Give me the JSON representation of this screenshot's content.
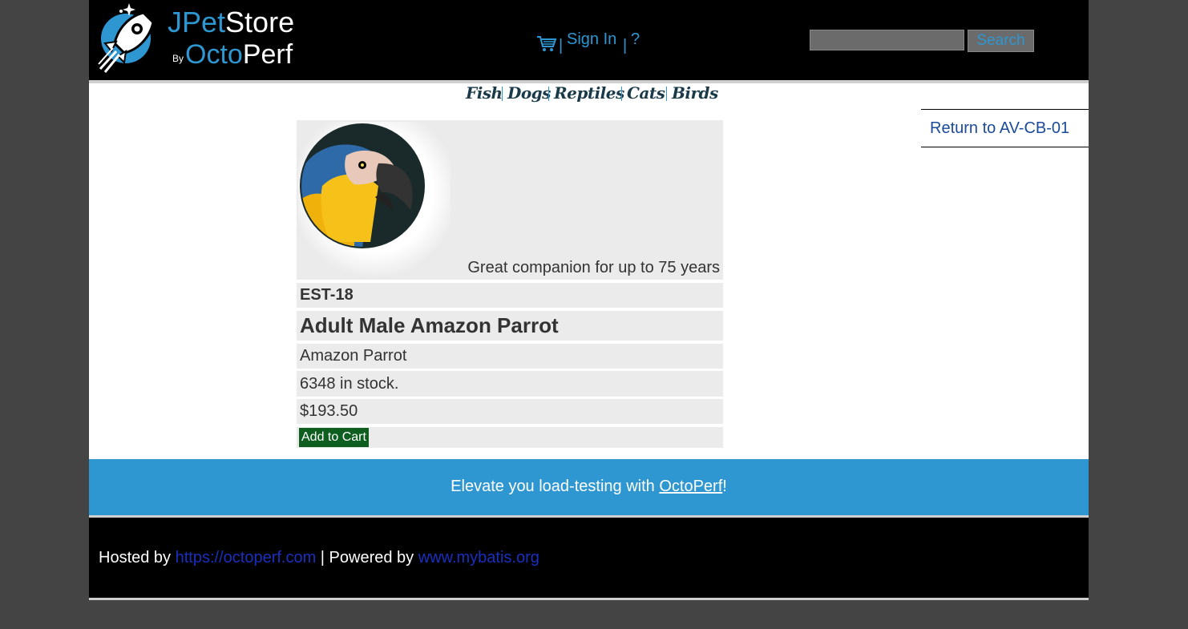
{
  "header": {
    "logo": {
      "jpet_part1": "JPet",
      "jpet_part2": "Store",
      "by": "By",
      "octo_part1": "Octo",
      "octo_part2": "Perf"
    },
    "menu": {
      "cart_icon": "shopping-cart-icon",
      "sign_in": "Sign In",
      "help": "?",
      "separator": "|"
    },
    "search": {
      "value": "",
      "button_label": "Search"
    }
  },
  "quicklinks": [
    "Fish",
    "Dogs",
    "Reptiles",
    "Cats",
    "Birds"
  ],
  "backlink": "Return to AV-CB-01",
  "item": {
    "image_caption": "Great companion for up to 75 years",
    "id": "EST-18",
    "name": "Adult Male Amazon Parrot",
    "product": "Amazon Parrot",
    "stock": "6348 in stock.",
    "price": "$193.50",
    "add_to_cart": "Add to Cart"
  },
  "promo": {
    "prefix": "Elevate you load-testing with ",
    "link": "OctoPerf",
    "suffix": "!"
  },
  "footer": {
    "hosted_by": "Hosted by ",
    "hosted_link": "https://octoperf.com",
    "powered_by": " | Powered by ",
    "powered_link": "www.mybatis.org"
  },
  "colors": {
    "accent": "#2e97d1",
    "header_bg": "#000000",
    "cart_button": "#0d5e1f",
    "page_bg": "#444444",
    "cell_bg": "#ebebeb"
  }
}
